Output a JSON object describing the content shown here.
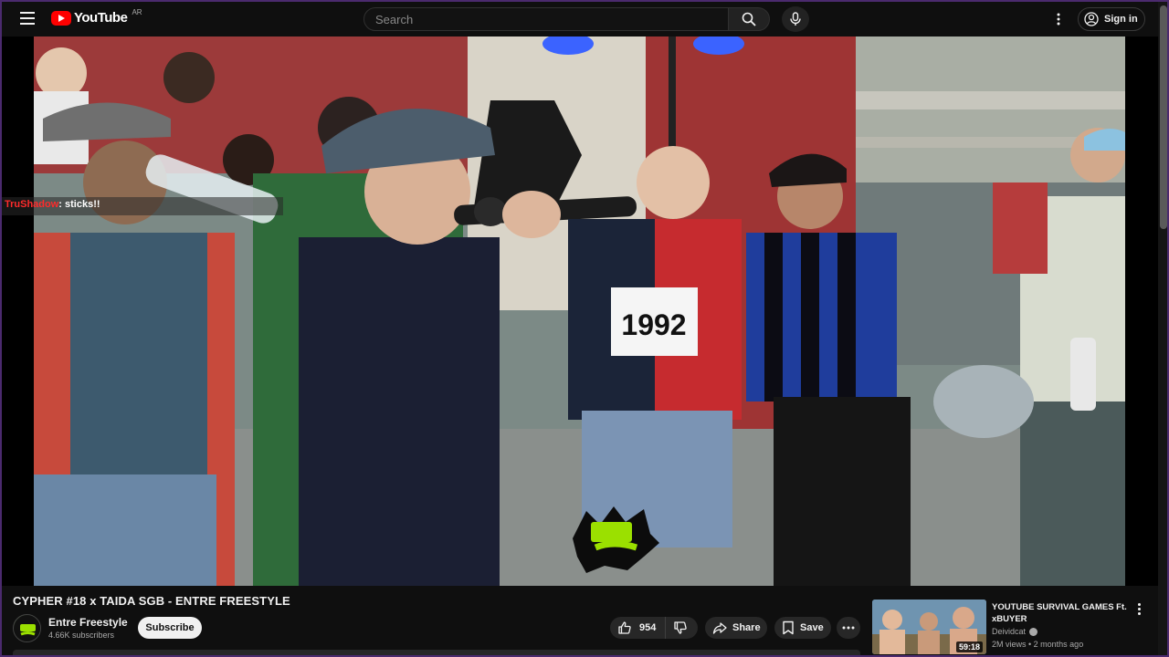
{
  "header": {
    "logo_text": "YouTube",
    "country_code": "AR",
    "search_placeholder": "Search",
    "signin_label": "Sign in"
  },
  "player": {
    "chat_user": "TruShadow",
    "chat_message": ": sticks!!",
    "shirt_text": "1992"
  },
  "video": {
    "title": "CYPHER #18 x TAIDA SGB - ENTRE FREESTYLE",
    "channel_name": "Entre Freestyle",
    "subscribers": "4.66K subscribers",
    "subscribe_label": "Subscribe",
    "like_count": "954",
    "share_label": "Share",
    "save_label": "Save"
  },
  "recommendation": {
    "title": "YOUTUBE SURVIVAL GAMES Ft. xBUYER",
    "channel": "Deividcat",
    "meta": "2M views • 2 months ago",
    "duration": "59:18"
  }
}
